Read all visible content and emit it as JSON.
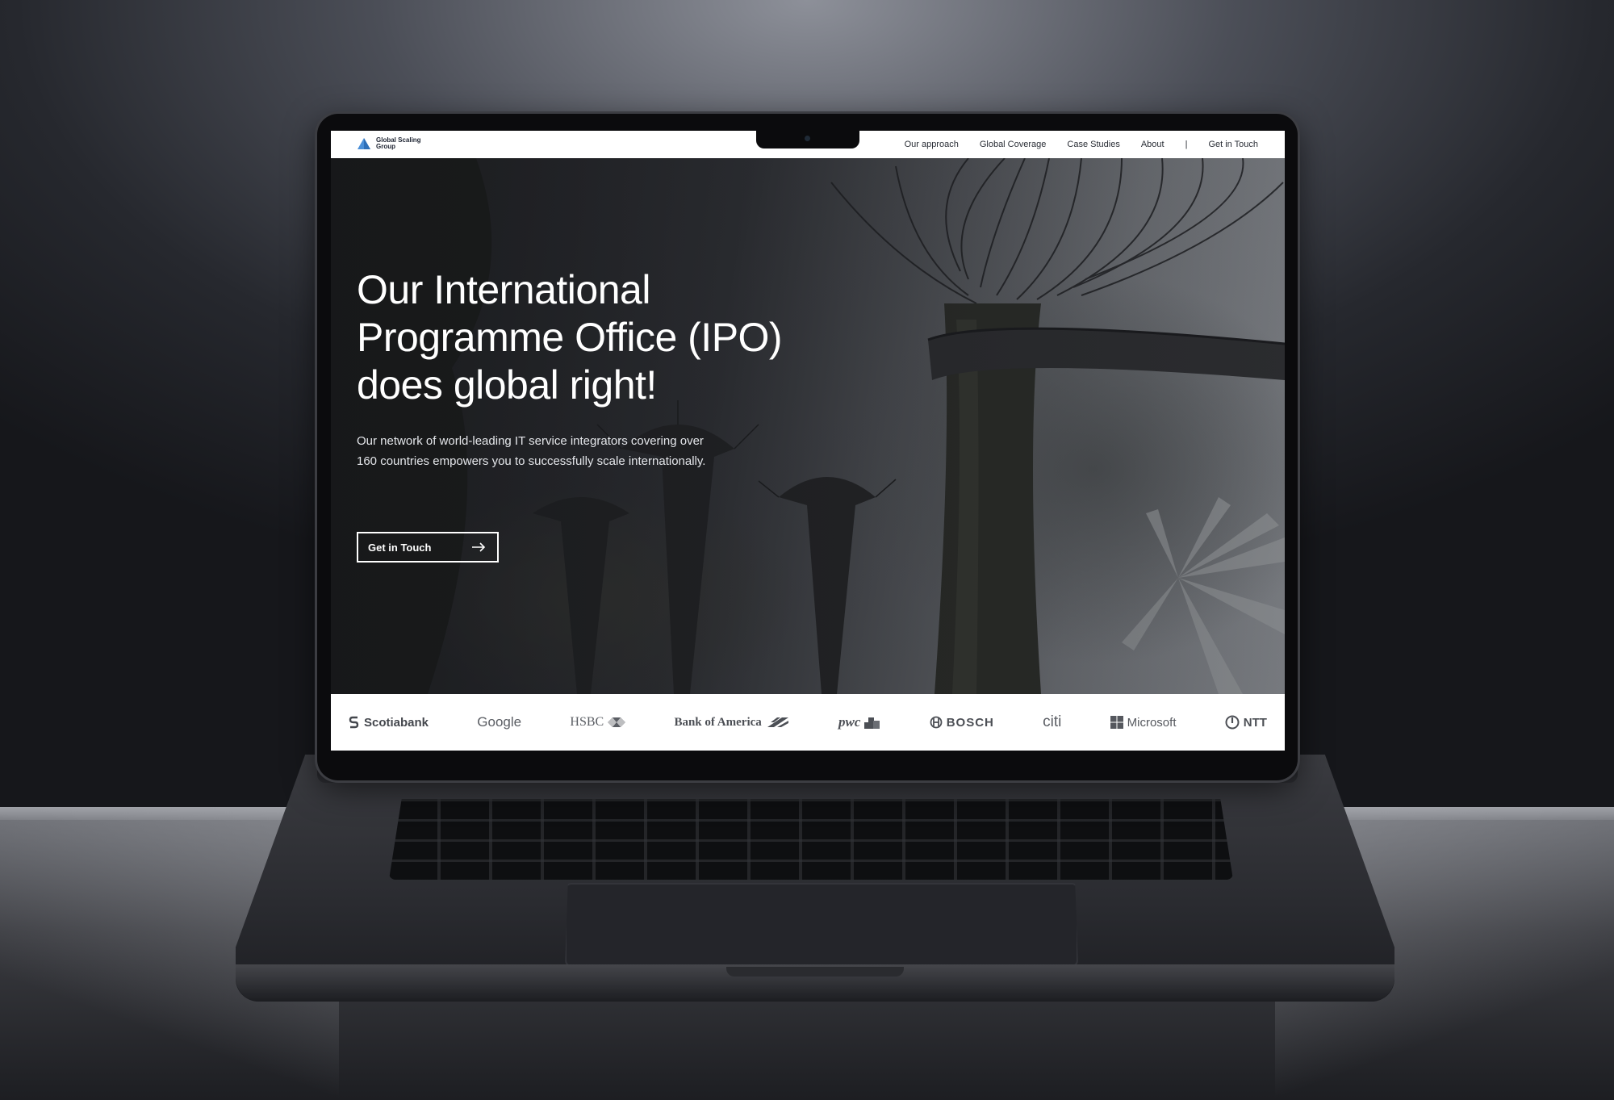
{
  "site": {
    "logo_text": "Global Scaling Group"
  },
  "nav": {
    "links": [
      "Our approach",
      "Global Coverage",
      "Case Studies",
      "About"
    ],
    "separator": "|",
    "cta": "Get in Touch"
  },
  "hero": {
    "title": "Our International Programme Office (IPO) does global right!",
    "subtitle": "Our network of world-leading IT service integrators covering over 160 countries empowers you to successfully scale internationally.",
    "cta_label": "Get in Touch"
  },
  "partners": [
    "Scotiabank",
    "Google",
    "HSBC",
    "Bank of America",
    "pwc",
    "BOSCH",
    "citi",
    "Microsoft",
    "NTT"
  ],
  "colors": {
    "nav_bg": "#ffffff",
    "logo_accent": "#4a8fd8",
    "hero_text": "#ffffff",
    "logos_bg": "#ffffff",
    "logo_grey": "#55585e"
  },
  "icons": {
    "logo": "triangle-logo-icon",
    "cta": "arrow-right-icon",
    "camera": "camera-icon"
  }
}
